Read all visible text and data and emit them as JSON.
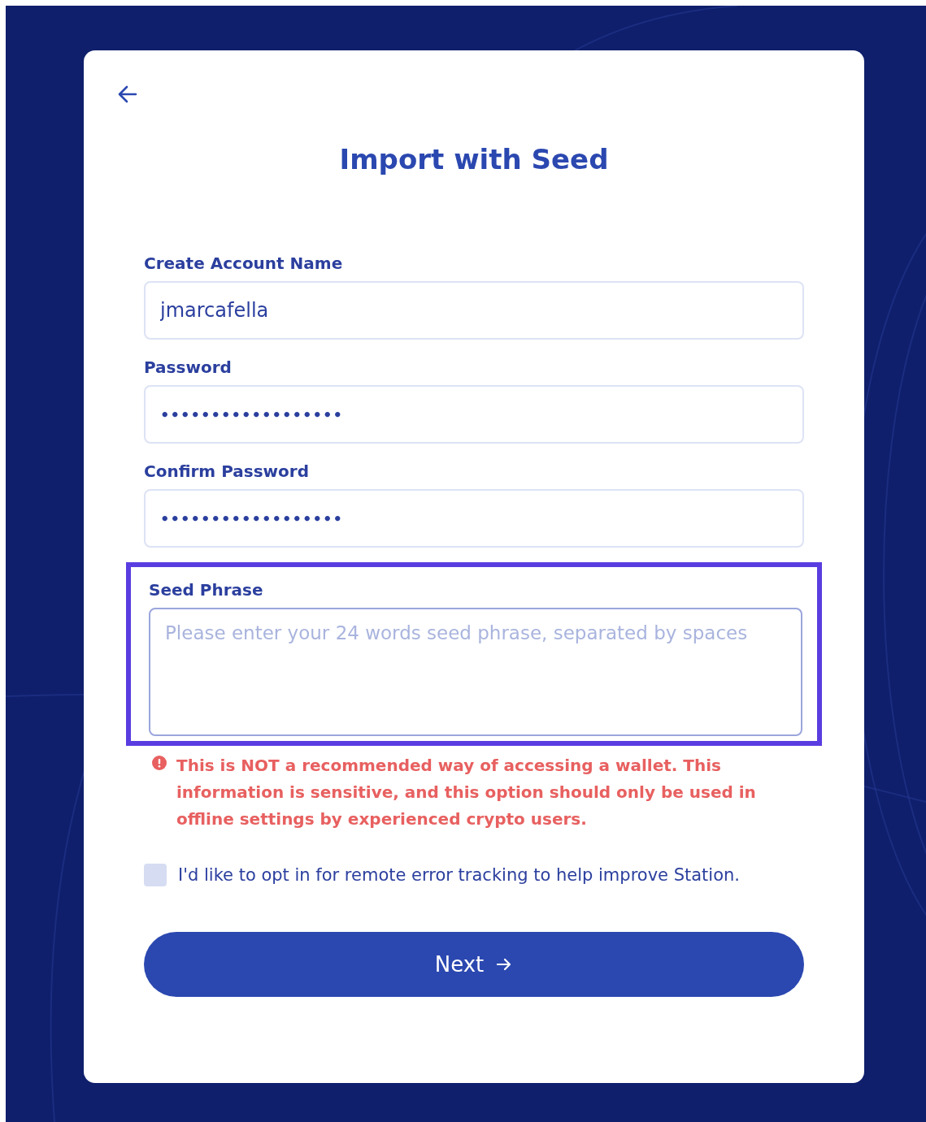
{
  "back_button": {
    "kind": "arrow"
  },
  "title": "Import with Seed",
  "fields": [
    {
      "label": "Create Account Name",
      "kind": "text",
      "value": "jmarcafella",
      "highlighted": false
    },
    {
      "label": "Password",
      "kind": "password",
      "value": "••••••••••••••••••",
      "highlighted": false
    },
    {
      "label": "Confirm Password",
      "kind": "password",
      "value": "••••••••••••••••••",
      "highlighted": false
    },
    {
      "label": "Seed Phrase",
      "kind": "textarea",
      "placeholder": "Please enter your 24 words seed phrase, separated by spaces",
      "highlighted": true
    }
  ],
  "warning": "This is NOT a recommended way of accessing a wallet. This information is sensitive, and this option should only be used in offline settings by experienced crypto users.",
  "opt_in": {
    "label": "I'd like to opt in for remote error tracking to help improve Station.",
    "checked": false
  },
  "next_button": {
    "label": "Next"
  }
}
